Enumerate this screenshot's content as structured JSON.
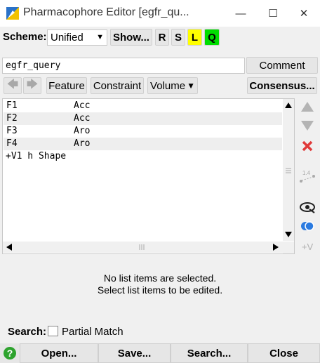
{
  "window": {
    "title": "Pharmacophore Editor [egfr_qu...",
    "min_glyph": "—",
    "max_glyph": "☐",
    "close_glyph": "✕"
  },
  "toolbar": {
    "scheme_label": "Scheme:",
    "scheme_value": "Unified",
    "show_label": "Show...",
    "r_label": "R",
    "s_label": "S",
    "l_label": "L",
    "q_label": "Q",
    "l_color": "#ffff00",
    "q_color": "#00dd00"
  },
  "query": {
    "name_value": "egfr_query",
    "comment_label": "Comment"
  },
  "actions": {
    "back_icon": "left-arrow-icon",
    "forward_icon": "right-arrow-icon",
    "feature_label": "Feature",
    "constraint_label": "Constraint",
    "volume_label": "Volume",
    "consensus_label": "Consensus..."
  },
  "list": {
    "rows": [
      {
        "name": "F1",
        "type": "Acc"
      },
      {
        "name": "F2",
        "type": "Acc"
      },
      {
        "name": "F3",
        "type": "Aro"
      },
      {
        "name": "F4",
        "type": "Aro"
      },
      {
        "name": "+V1 h Shape",
        "type": ""
      }
    ]
  },
  "side": {
    "plus_v_label": "+V",
    "dist_label": "1.4"
  },
  "info": {
    "line1": "No list items are selected.",
    "line2": "Select list items to be edited."
  },
  "search": {
    "label": "Search:",
    "partial_match_label": "Partial Match"
  },
  "bottom": {
    "help_glyph": "?",
    "open_label": "Open...",
    "save_label": "Save...",
    "search_label": "Search...",
    "close_label": "Close"
  }
}
